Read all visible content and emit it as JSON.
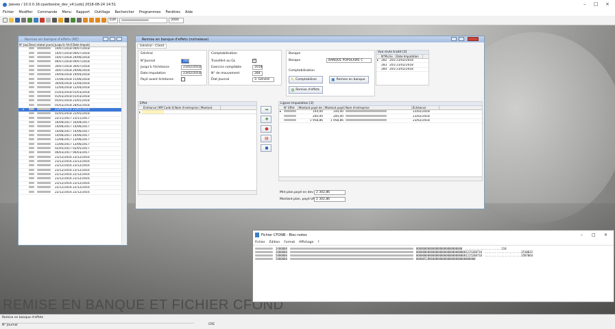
{
  "app": {
    "title": "Jeeves / 10.0.0.16:cparbosine_dev_v4 [uob]   2018-08-24 14:51",
    "window_controls": [
      "–",
      "□",
      "×"
    ]
  },
  "menu": [
    "Fichier",
    "Modifier",
    "Commande",
    "Menu",
    "Rapport",
    "Outillage",
    "Rechercher",
    "Programmes",
    "Fenêtres",
    "Aide"
  ],
  "toolbar": {
    "currency": "EUR",
    "year": "2000"
  },
  "list_window": {
    "title": "Remise en banque d'effets (RE)",
    "columns": [
      "N° Jour",
      "Descr.",
      "statut journal",
      "Jusqu'à l'échéa",
      "Date Imputati"
    ],
    "rows": [
      [
        "19/07/2018",
        "09/07/2018"
      ],
      [
        "10/07/2018",
        "09/07/2018"
      ],
      [
        "10/07/2018",
        "29/06/2018"
      ],
      [
        "06/07/2018",
        "09/07/2018"
      ],
      [
        "30/07/2018",
        "30/07/2018"
      ],
      [
        "30/07/2018",
        "29/06/2018"
      ],
      [
        "19/04/2018",
        "19/04/2018"
      ],
      [
        "15/06/2018",
        "15/06/2018"
      ],
      [
        "30/04/2018",
        "12/04/2018"
      ],
      [
        "12/04/2018",
        "12/04/2018"
      ],
      [
        "01/03/2018",
        "01/03/2018"
      ],
      [
        "01/03/2018",
        "01/03/2018"
      ],
      [
        "05/01/2018",
        "23/01/2018"
      ],
      [
        "05/03/2018",
        "28/02/2018"
      ],
      [
        "23/02/2018",
        "23/02/2018"
      ],
      [
        "02/05/2018",
        "31/05/2018"
      ],
      [
        "22/11/2017",
        "23/11/2017"
      ],
      [
        "16/09/2017",
        "16/09/2017"
      ],
      [
        "14/06/2017",
        "14/06/2017"
      ],
      [
        "14/06/2017",
        "14/06/2017"
      ],
      [
        "14/06/2017",
        "14/06/2017"
      ],
      [
        "13/06/2017",
        "13/06/2017"
      ],
      [
        "13/06/2017",
        "13/06/2017"
      ],
      [
        "02/05/2017",
        "02/05/2017"
      ],
      [
        "06/03/2017",
        "06/03/2017"
      ],
      [
        "23/12/2016",
        "23/12/2016"
      ],
      [
        "23/12/2016",
        "23/12/2016"
      ],
      [
        "23/12/2016",
        "23/12/2016"
      ],
      [
        "23/12/2016",
        "23/12/2016"
      ],
      [
        "22/12/2016",
        "22/12/2016"
      ],
      [
        "23/12/2016",
        "23/12/2016"
      ],
      [
        "23/12/2016",
        "23/12/2016"
      ],
      [
        "22/12/2016",
        "22/12/2016"
      ],
      [
        "22/12/2016",
        "22/12/2016"
      ]
    ],
    "selected_index": 14
  },
  "detail_window": {
    "title": "Remise en banque d'effets (notraiwue)",
    "tab": "Général - Client",
    "general": {
      "header": "Général",
      "journal_label": "N°Journal",
      "journal_value": "282",
      "echeance_label": "Jusqu'à l'échéance",
      "echeance_value": "23/02/2018",
      "imputation_label": "Date Imputation",
      "imputation_value": "23/02/2018",
      "payé_label": "Payé avant échéance"
    },
    "compta": {
      "header": "Comptabilisation",
      "gl_label": "Transféré au GL",
      "exercice_label": "Exercice comptable",
      "exercice_value": "2018",
      "mouvement_label": "N° de mouvement",
      "mouvement_value": "284",
      "etat_label": "État Journal",
      "etat_value": "3. Généré"
    },
    "banque": {
      "header": "Banque",
      "banque_label": "Banque",
      "banque_value": "BANQUE POPULAIRE C",
      "compta_header": "Comptabilisation",
      "btn_compta": "Comptabiliser",
      "btn_remise": "Remise en banque",
      "btn_remise_effets": "Remise d'effets"
    },
    "journals": {
      "header": "Vue mvts traité [3]",
      "columns": [
        "N°Mvt",
        "Ex",
        "Date Imputation"
      ],
      "rows": [
        [
          "282",
          "2018",
          "23/02/2018"
        ],
        [
          "283",
          "2018",
          "23/02/2018"
        ],
        [
          "284",
          "2018",
          "23/02/2018"
        ]
      ]
    },
    "effet": {
      "header": "Effet",
      "columns": [
        "Échéance",
        "MP",
        "Code tiers",
        "Nom d'entreprise",
        "Montant"
      ]
    },
    "lignes": {
      "header": "Lignes Imputation [3]",
      "columns": [
        "N° Effet",
        "Montant payé de",
        "Montant payé",
        "Nom d'entreprise",
        "Échéance"
      ],
      "rows": [
        [
          "144,00",
          "144,00",
          "23/02/2018"
        ],
        [
          "200,00",
          "200,00",
          "23/02/2018"
        ],
        [
          "1 958,86",
          "1 958,86",
          "23/02/2018"
        ]
      ]
    },
    "totals": {
      "label1": "Mnt plan.payé en dev",
      "value1": "2 302,86",
      "label2": "Montant plan. payé UMB",
      "value2": "2 302,86"
    }
  },
  "notepad": {
    "title": "Fichier CFONB - Bloc-notes",
    "menu": [
      "Fichier",
      "Édition",
      "Format",
      "Affichage",
      "?"
    ],
    "lines": [
      {
        "a": "3400000",
        "b": "0000000000000000000000000000",
        "c": "......................110"
      },
      {
        "a": "2000000",
        "b": "0000000000000000000000000000001215260716",
        "c": "......................3510032"
      },
      {
        "a": "5800000",
        "b": "0000000000000000000000000000001215260716",
        "c": "......................3507064"
      },
      {
        "a": "5800000",
        "b": "000005208600000000000000000000000000",
        "c": ""
      }
    ]
  },
  "overlay_caption": "REMISE EN BANQUE ET FICHIER CFOND",
  "status": {
    "line1": "Remise en banque d'effets",
    "line2": "N° Journal",
    "line3": "CRE"
  },
  "colors": {
    "accent": "#3b78d8",
    "title_gradient": "#a9c2e6",
    "caption": "#4c4c4c"
  }
}
